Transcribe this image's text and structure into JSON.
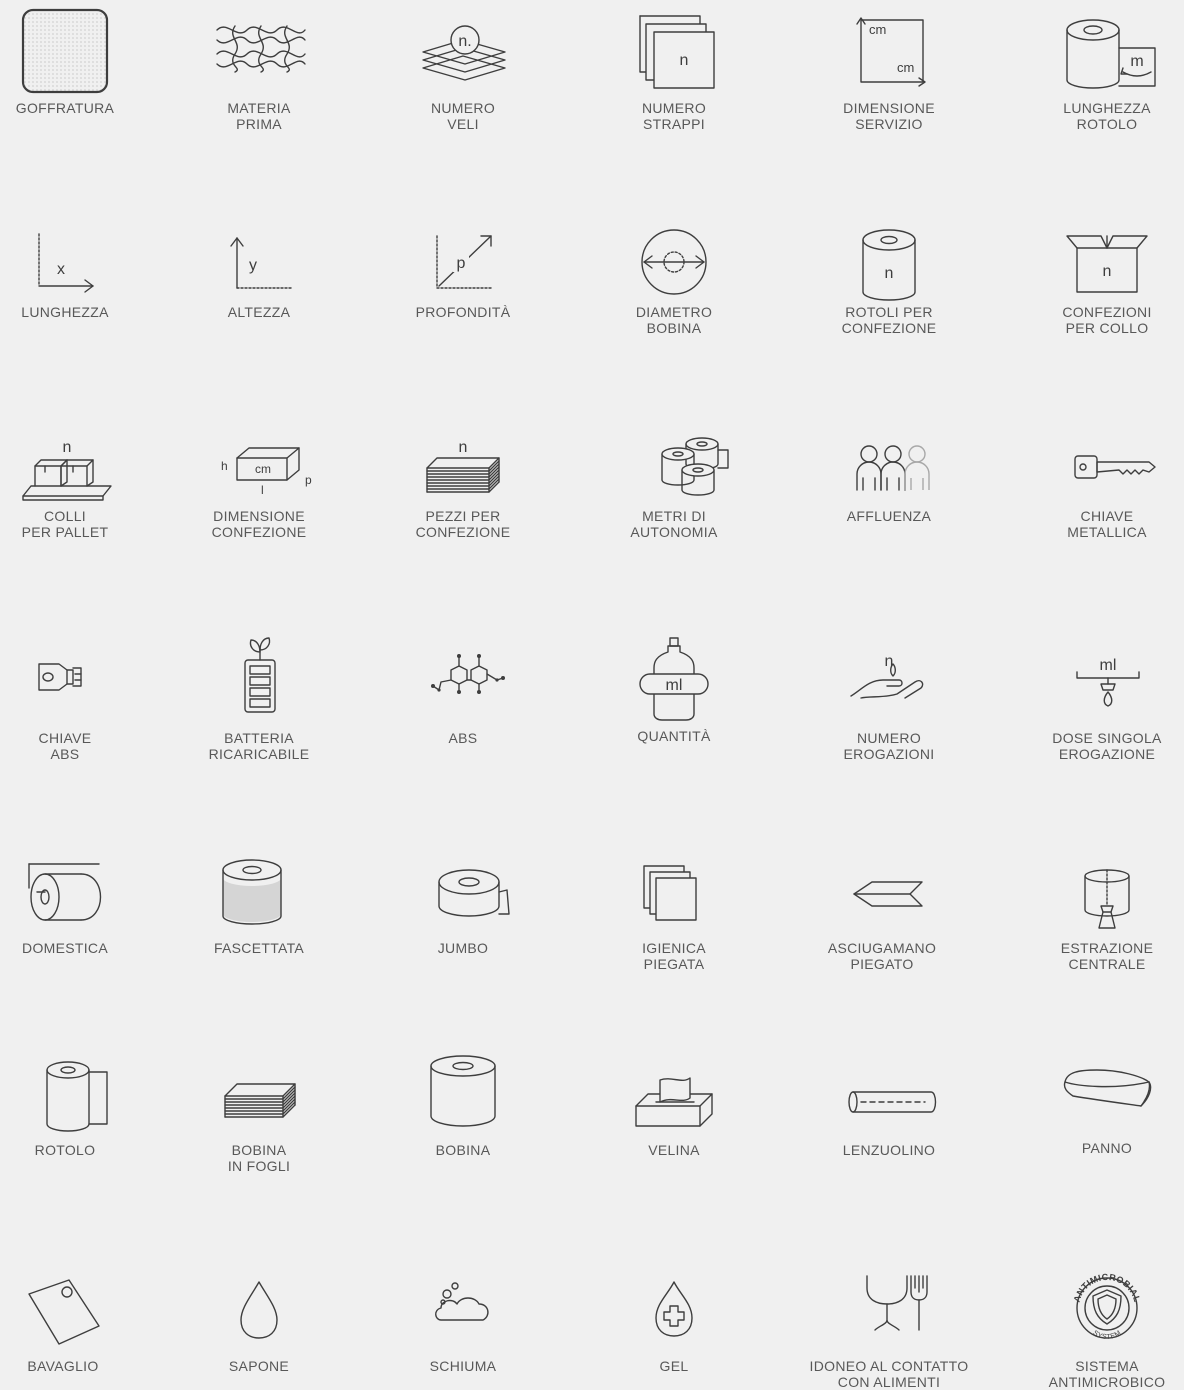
{
  "icons": [
    {
      "icon": "goffratura-icon",
      "lines": [
        "GOFFRATURA"
      ]
    },
    {
      "icon": "materia-prima-icon",
      "lines": [
        "MATERIA",
        "PRIMA"
      ]
    },
    {
      "icon": "numero-veli-icon",
      "lines": [
        "NUMERO",
        "VELI"
      ],
      "glyph": "n."
    },
    {
      "icon": "numero-strappi-icon",
      "lines": [
        "NUMERO",
        "STRAPPI"
      ],
      "glyph": "n"
    },
    {
      "icon": "dimensione-servizio-icon",
      "lines": [
        "DIMENSIONE",
        "SERVIZIO"
      ],
      "glyph": "cm",
      "glyph2": "cm"
    },
    {
      "icon": "lunghezza-rotolo-icon",
      "lines": [
        "LUNGHEZZA",
        "ROTOLO"
      ],
      "glyph": "m"
    },
    {
      "icon": "lunghezza-icon",
      "lines": [
        "LUNGHEZZA"
      ],
      "glyph": "x"
    },
    {
      "icon": "altezza-icon",
      "lines": [
        "ALTEZZA"
      ],
      "glyph": "y"
    },
    {
      "icon": "profondita-icon",
      "lines": [
        "PROFONDITÀ"
      ],
      "glyph": "p"
    },
    {
      "icon": "diametro-bobina-icon",
      "lines": [
        "DIAMETRO",
        "BOBINA"
      ]
    },
    {
      "icon": "rotoli-per-confezione-icon",
      "lines": [
        "ROTOLI PER",
        "CONFEZIONE"
      ],
      "glyph": "n"
    },
    {
      "icon": "confezioni-per-collo-icon",
      "lines": [
        "CONFEZIONI",
        "PER COLLO"
      ],
      "glyph": "n"
    },
    {
      "icon": "colli-per-pallet-icon",
      "lines": [
        "COLLI",
        "PER PALLET"
      ],
      "glyph": "n"
    },
    {
      "icon": "dimensione-confezione-icon",
      "lines": [
        "DIMENSIONE",
        "CONFEZIONE"
      ],
      "glyph": "cm",
      "glyph_h": "h",
      "glyph_l": "l",
      "glyph_p": "p"
    },
    {
      "icon": "pezzi-per-confezione-icon",
      "lines": [
        "PEZZI PER",
        "CONFEZIONE"
      ],
      "glyph": "n"
    },
    {
      "icon": "metri-di-autonomia-icon",
      "lines": [
        "METRI DI",
        "AUTONOMIA"
      ]
    },
    {
      "icon": "affluenza-icon",
      "lines": [
        "AFFLUENZA"
      ]
    },
    {
      "icon": "chiave-metallica-icon",
      "lines": [
        "CHIAVE",
        "METALLICA"
      ]
    },
    {
      "icon": "chiave-abs-icon",
      "lines": [
        "CHIAVE",
        "ABS"
      ]
    },
    {
      "icon": "batteria-ricaricabile-icon",
      "lines": [
        "BATTERIA",
        "RICARICABILE"
      ]
    },
    {
      "icon": "abs-icon",
      "lines": [
        "ABS"
      ]
    },
    {
      "icon": "quantita-icon",
      "lines": [
        "QUANTITÀ"
      ],
      "glyph": "ml"
    },
    {
      "icon": "numero-erogazioni-icon",
      "lines": [
        "NUMERO",
        "EROGAZIONI"
      ],
      "glyph": "n"
    },
    {
      "icon": "dose-singola-erogazione-icon",
      "lines": [
        "DOSE SINGOLA",
        "EROGAZIONE"
      ],
      "glyph": "ml"
    },
    {
      "icon": "domestica-icon",
      "lines": [
        "DOMESTICA"
      ]
    },
    {
      "icon": "fascettata-icon",
      "lines": [
        "FASCETTATA"
      ]
    },
    {
      "icon": "jumbo-icon",
      "lines": [
        "JUMBO"
      ]
    },
    {
      "icon": "igienica-piegata-icon",
      "lines": [
        "IGIENICA",
        "PIEGATA"
      ]
    },
    {
      "icon": "asciugamano-piegato-icon",
      "lines": [
        "ASCIUGAMANO",
        "PIEGATO"
      ]
    },
    {
      "icon": "estrazione-centrale-icon",
      "lines": [
        "ESTRAZIONE",
        "CENTRALE"
      ]
    },
    {
      "icon": "rotolo-icon",
      "lines": [
        "ROTOLO"
      ]
    },
    {
      "icon": "bobina-in-fogli-icon",
      "lines": [
        "BOBINA",
        "IN FOGLI"
      ]
    },
    {
      "icon": "bobina-icon",
      "lines": [
        "BOBINA"
      ]
    },
    {
      "icon": "velina-icon",
      "lines": [
        "VELINA"
      ]
    },
    {
      "icon": "lenzuolino-icon",
      "lines": [
        "LENZUOLINO"
      ]
    },
    {
      "icon": "panno-icon",
      "lines": [
        "PANNO"
      ]
    },
    {
      "icon": "bavaglio-icon",
      "lines": [
        "BAVAGLIO"
      ]
    },
    {
      "icon": "sapone-icon",
      "lines": [
        "SAPONE"
      ]
    },
    {
      "icon": "schiuma-icon",
      "lines": [
        "SCHIUMA"
      ]
    },
    {
      "icon": "gel-icon",
      "lines": [
        "GEL"
      ]
    },
    {
      "icon": "idoneo-contatto-alimenti-icon",
      "lines": [
        "IDONEO AL CONTATTO",
        "CON ALIMENTI"
      ]
    },
    {
      "icon": "sistema-antimicrobico-icon",
      "lines": [
        "SISTEMA",
        "ANTIMICROBICO"
      ],
      "seal_top": "ANTIMICROBIAL",
      "seal_bottom": "SYSTEM"
    }
  ],
  "colors": {
    "background": "#f0f0f0",
    "ink": "#3e3e3e",
    "label": "#585858"
  }
}
